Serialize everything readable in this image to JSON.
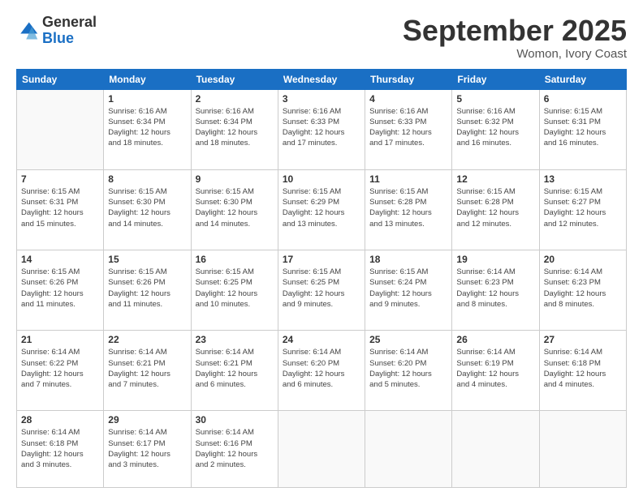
{
  "logo": {
    "line1": "General",
    "line2": "Blue"
  },
  "title": "September 2025",
  "location": "Womon, Ivory Coast",
  "weekdays": [
    "Sunday",
    "Monday",
    "Tuesday",
    "Wednesday",
    "Thursday",
    "Friday",
    "Saturday"
  ],
  "days": [
    {
      "date": "",
      "info": ""
    },
    {
      "date": "1",
      "info": "Sunrise: 6:16 AM\nSunset: 6:34 PM\nDaylight: 12 hours\nand 18 minutes."
    },
    {
      "date": "2",
      "info": "Sunrise: 6:16 AM\nSunset: 6:34 PM\nDaylight: 12 hours\nand 18 minutes."
    },
    {
      "date": "3",
      "info": "Sunrise: 6:16 AM\nSunset: 6:33 PM\nDaylight: 12 hours\nand 17 minutes."
    },
    {
      "date": "4",
      "info": "Sunrise: 6:16 AM\nSunset: 6:33 PM\nDaylight: 12 hours\nand 17 minutes."
    },
    {
      "date": "5",
      "info": "Sunrise: 6:16 AM\nSunset: 6:32 PM\nDaylight: 12 hours\nand 16 minutes."
    },
    {
      "date": "6",
      "info": "Sunrise: 6:15 AM\nSunset: 6:31 PM\nDaylight: 12 hours\nand 16 minutes."
    },
    {
      "date": "7",
      "info": "Sunrise: 6:15 AM\nSunset: 6:31 PM\nDaylight: 12 hours\nand 15 minutes."
    },
    {
      "date": "8",
      "info": "Sunrise: 6:15 AM\nSunset: 6:30 PM\nDaylight: 12 hours\nand 14 minutes."
    },
    {
      "date": "9",
      "info": "Sunrise: 6:15 AM\nSunset: 6:30 PM\nDaylight: 12 hours\nand 14 minutes."
    },
    {
      "date": "10",
      "info": "Sunrise: 6:15 AM\nSunset: 6:29 PM\nDaylight: 12 hours\nand 13 minutes."
    },
    {
      "date": "11",
      "info": "Sunrise: 6:15 AM\nSunset: 6:28 PM\nDaylight: 12 hours\nand 13 minutes."
    },
    {
      "date": "12",
      "info": "Sunrise: 6:15 AM\nSunset: 6:28 PM\nDaylight: 12 hours\nand 12 minutes."
    },
    {
      "date": "13",
      "info": "Sunrise: 6:15 AM\nSunset: 6:27 PM\nDaylight: 12 hours\nand 12 minutes."
    },
    {
      "date": "14",
      "info": "Sunrise: 6:15 AM\nSunset: 6:26 PM\nDaylight: 12 hours\nand 11 minutes."
    },
    {
      "date": "15",
      "info": "Sunrise: 6:15 AM\nSunset: 6:26 PM\nDaylight: 12 hours\nand 11 minutes."
    },
    {
      "date": "16",
      "info": "Sunrise: 6:15 AM\nSunset: 6:25 PM\nDaylight: 12 hours\nand 10 minutes."
    },
    {
      "date": "17",
      "info": "Sunrise: 6:15 AM\nSunset: 6:25 PM\nDaylight: 12 hours\nand 9 minutes."
    },
    {
      "date": "18",
      "info": "Sunrise: 6:15 AM\nSunset: 6:24 PM\nDaylight: 12 hours\nand 9 minutes."
    },
    {
      "date": "19",
      "info": "Sunrise: 6:14 AM\nSunset: 6:23 PM\nDaylight: 12 hours\nand 8 minutes."
    },
    {
      "date": "20",
      "info": "Sunrise: 6:14 AM\nSunset: 6:23 PM\nDaylight: 12 hours\nand 8 minutes."
    },
    {
      "date": "21",
      "info": "Sunrise: 6:14 AM\nSunset: 6:22 PM\nDaylight: 12 hours\nand 7 minutes."
    },
    {
      "date": "22",
      "info": "Sunrise: 6:14 AM\nSunset: 6:21 PM\nDaylight: 12 hours\nand 7 minutes."
    },
    {
      "date": "23",
      "info": "Sunrise: 6:14 AM\nSunset: 6:21 PM\nDaylight: 12 hours\nand 6 minutes."
    },
    {
      "date": "24",
      "info": "Sunrise: 6:14 AM\nSunset: 6:20 PM\nDaylight: 12 hours\nand 6 minutes."
    },
    {
      "date": "25",
      "info": "Sunrise: 6:14 AM\nSunset: 6:20 PM\nDaylight: 12 hours\nand 5 minutes."
    },
    {
      "date": "26",
      "info": "Sunrise: 6:14 AM\nSunset: 6:19 PM\nDaylight: 12 hours\nand 4 minutes."
    },
    {
      "date": "27",
      "info": "Sunrise: 6:14 AM\nSunset: 6:18 PM\nDaylight: 12 hours\nand 4 minutes."
    },
    {
      "date": "28",
      "info": "Sunrise: 6:14 AM\nSunset: 6:18 PM\nDaylight: 12 hours\nand 3 minutes."
    },
    {
      "date": "29",
      "info": "Sunrise: 6:14 AM\nSunset: 6:17 PM\nDaylight: 12 hours\nand 3 minutes."
    },
    {
      "date": "30",
      "info": "Sunrise: 6:14 AM\nSunset: 6:16 PM\nDaylight: 12 hours\nand 2 minutes."
    },
    {
      "date": "",
      "info": ""
    },
    {
      "date": "",
      "info": ""
    },
    {
      "date": "",
      "info": ""
    },
    {
      "date": "",
      "info": ""
    }
  ]
}
